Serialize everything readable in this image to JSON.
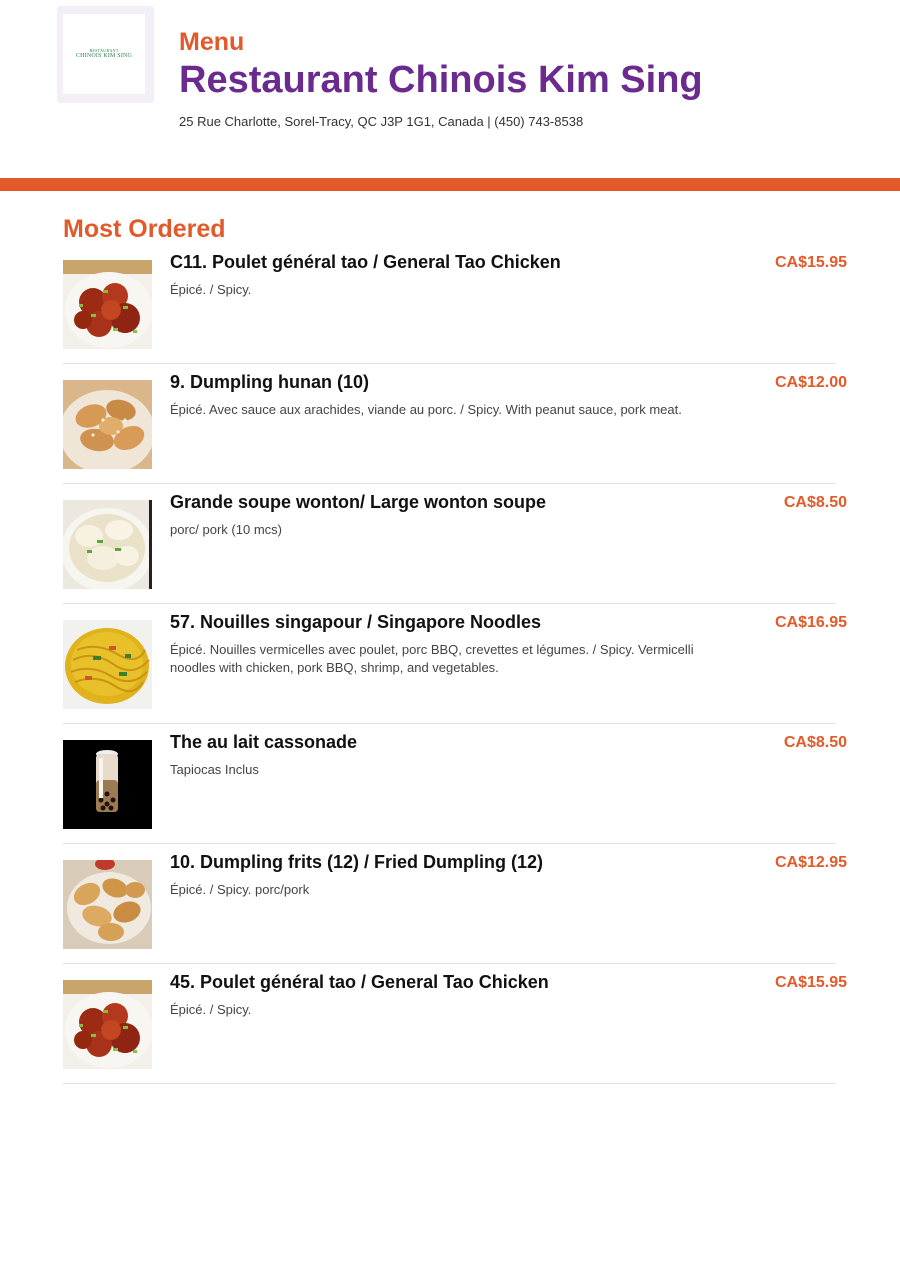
{
  "header": {
    "logo": {
      "small_text": "RESTAURANT",
      "main_text": "CHINOIS KIM SING"
    },
    "menu_label": "Menu",
    "restaurant_name": "Restaurant Chinois Kim Sing",
    "address": "25 Rue Charlotte, Sorel-Tracy, QC J3P 1G1, Canada | (450) 743-8538"
  },
  "section": {
    "title": "Most Ordered"
  },
  "items": [
    {
      "name": "C11. Poulet général tao / General Tao Chicken",
      "desc": "Épicé. / Spicy.",
      "price": "CA$15.95",
      "image_icon": "general-tao-chicken-photo"
    },
    {
      "name": "9. Dumpling hunan (10)",
      "desc": "Épicé. Avec sauce aux arachides, viande au porc. / Spicy. With peanut sauce, pork meat.",
      "price": "CA$12.00",
      "image_icon": "hunan-dumpling-photo"
    },
    {
      "name": "Grande soupe wonton/ Large wonton soupe",
      "desc": "porc/ pork (10 mcs)",
      "price": "CA$8.50",
      "image_icon": "wonton-soup-photo"
    },
    {
      "name": "57. Nouilles singapour / Singapore Noodles",
      "desc": "Épicé. Nouilles vermicelles avec poulet, porc BBQ, crevettes et légumes. / Spicy. Vermicelli noodles with chicken, pork BBQ, shrimp, and vegetables.",
      "price": "CA$16.95",
      "image_icon": "singapore-noodles-photo"
    },
    {
      "name": "The au lait cassonade",
      "desc": "Tapiocas Inclus",
      "price": "CA$8.50",
      "image_icon": "bubble-tea-photo"
    },
    {
      "name": "10. Dumpling frits (12) / Fried Dumpling (12)",
      "desc": "Épicé. / Spicy. porc/pork",
      "price": "CA$12.95",
      "image_icon": "fried-dumpling-photo"
    },
    {
      "name": "45. Poulet général tao / General Tao Chicken",
      "desc": "Épicé. / Spicy.",
      "price": "CA$15.95",
      "image_icon": "general-tao-chicken-photo"
    }
  ],
  "colors": {
    "accent_orange": "#e35a2a",
    "brand_purple": "#6b2b8e",
    "logo_green": "#2e7d4f"
  }
}
